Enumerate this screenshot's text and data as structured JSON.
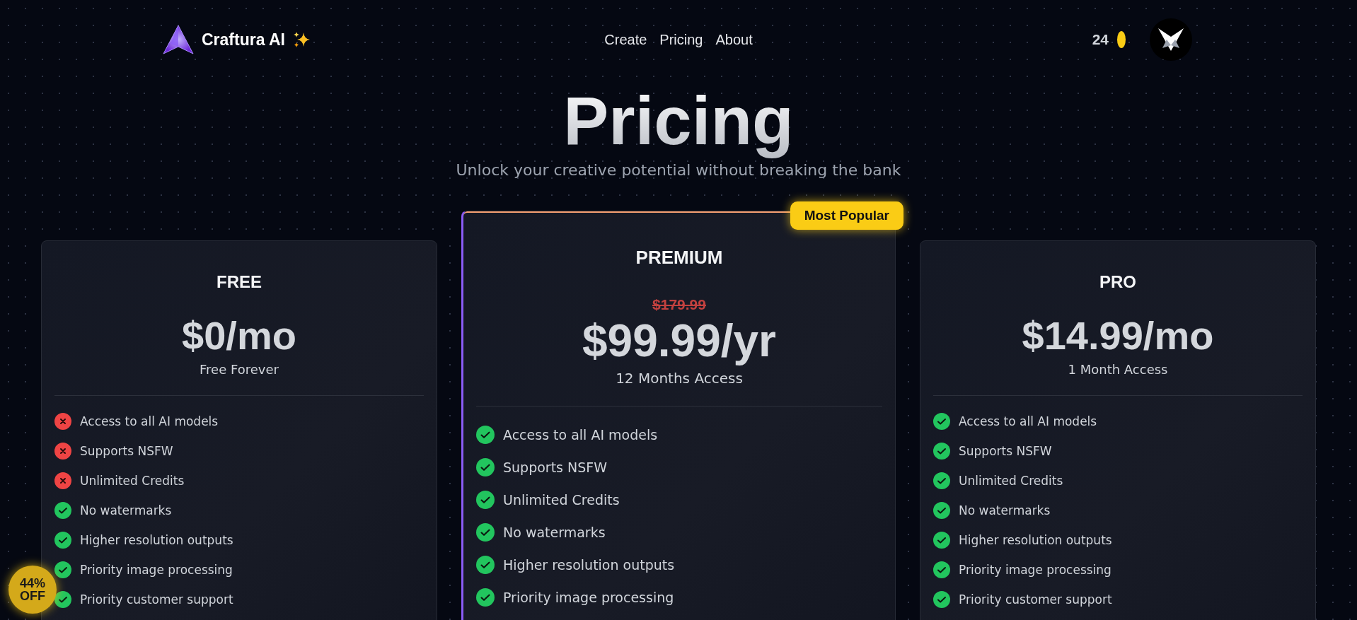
{
  "brand": {
    "name": "Craftura AI"
  },
  "nav": [
    {
      "label": "Create"
    },
    {
      "label": "Pricing"
    },
    {
      "label": "About"
    }
  ],
  "credits": "24",
  "hero": {
    "title": "Pricing",
    "subtitle": "Unlock your creative potential without breaking the bank"
  },
  "plans": [
    {
      "name": "FREE",
      "featured": false,
      "price": "$0/mo",
      "period": "Free Forever",
      "features": [
        {
          "label": "Access to all AI models",
          "included": false
        },
        {
          "label": "Supports NSFW",
          "included": false
        },
        {
          "label": "Unlimited Credits",
          "included": false
        },
        {
          "label": "No watermarks",
          "included": true
        },
        {
          "label": "Higher resolution outputs",
          "included": true
        },
        {
          "label": "Priority image processing",
          "included": true
        },
        {
          "label": "Priority customer support",
          "included": true
        }
      ]
    },
    {
      "name": "PREMIUM",
      "featured": true,
      "badge": "Most Popular",
      "old_price": "$179.99",
      "price": "$99.99/yr",
      "period": "12 Months Access",
      "features": [
        {
          "label": "Access to all AI models",
          "included": true
        },
        {
          "label": "Supports NSFW",
          "included": true
        },
        {
          "label": "Unlimited Credits",
          "included": true
        },
        {
          "label": "No watermarks",
          "included": true
        },
        {
          "label": "Higher resolution outputs",
          "included": true
        },
        {
          "label": "Priority image processing",
          "included": true
        }
      ]
    },
    {
      "name": "PRO",
      "featured": false,
      "price": "$14.99/mo",
      "period": "1 Month Access",
      "features": [
        {
          "label": "Access to all AI models",
          "included": true
        },
        {
          "label": "Supports NSFW",
          "included": true
        },
        {
          "label": "Unlimited Credits",
          "included": true
        },
        {
          "label": "No watermarks",
          "included": true
        },
        {
          "label": "Higher resolution outputs",
          "included": true
        },
        {
          "label": "Priority image processing",
          "included": true
        },
        {
          "label": "Priority customer support",
          "included": true
        }
      ]
    }
  ],
  "discount_badge": {
    "line1": "44%",
    "line2": "OFF"
  }
}
